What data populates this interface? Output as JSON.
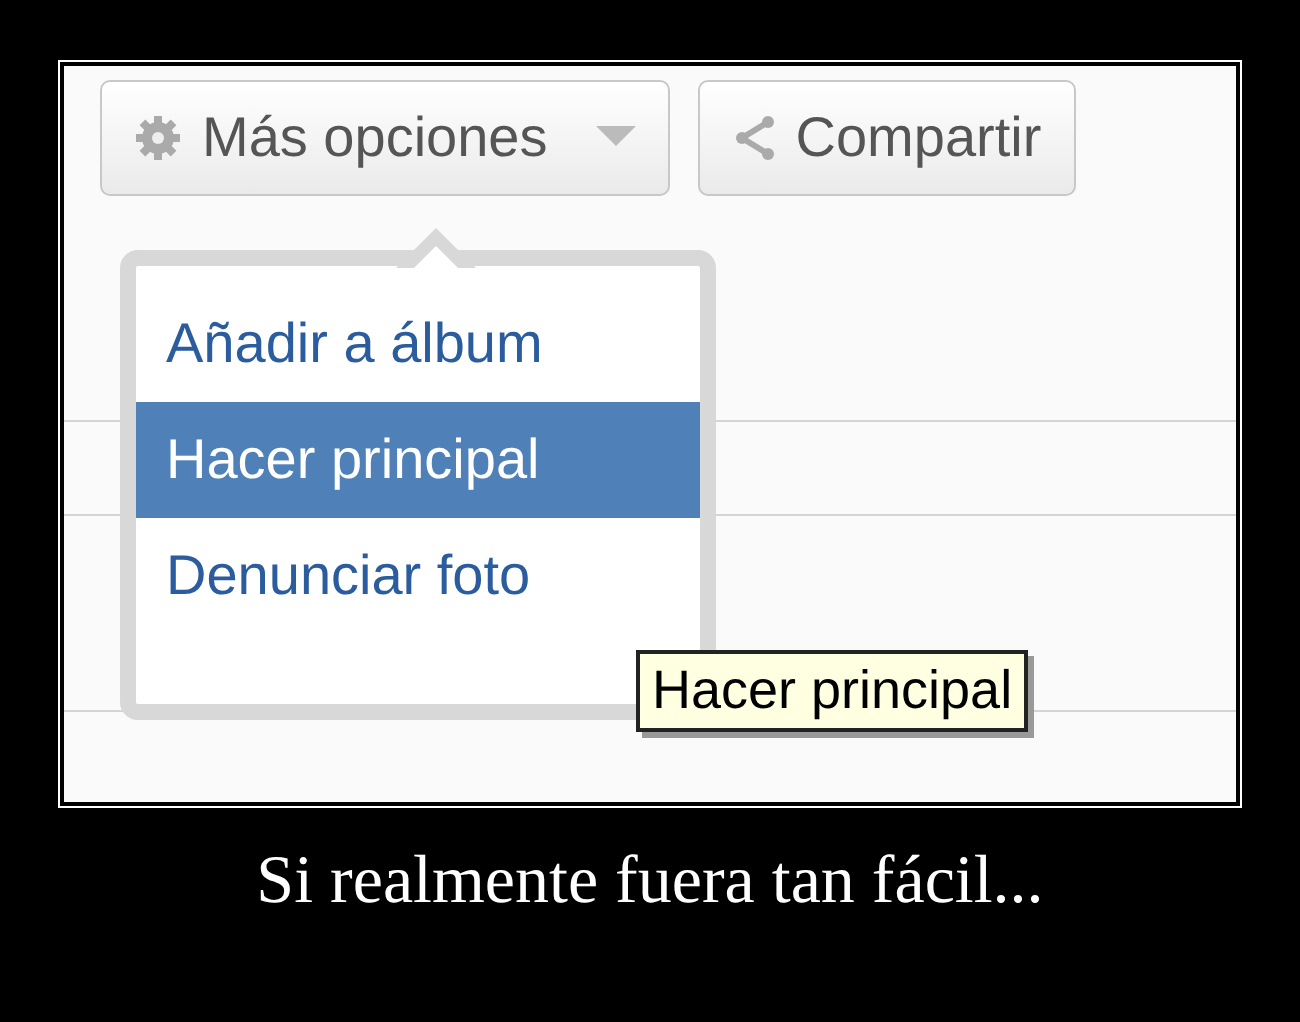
{
  "toolbar": {
    "buttons": [
      {
        "kind": "menu",
        "label": "Más opciones"
      },
      {
        "kind": "share",
        "label": "Compartir"
      }
    ]
  },
  "menu": {
    "items": [
      {
        "label": "Añadir a álbum",
        "selected": false
      },
      {
        "label": "Hacer principal",
        "selected": true
      },
      {
        "label": "Denunciar foto",
        "selected": false
      }
    ]
  },
  "tooltip": "Hacer principal",
  "caption": "Si realmente fuera tan fácil..."
}
